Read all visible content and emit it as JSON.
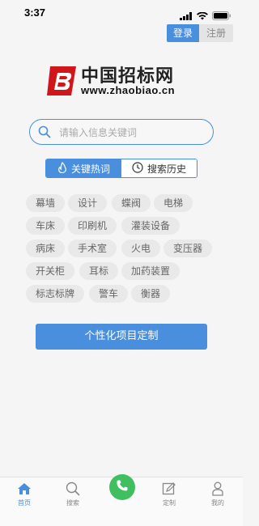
{
  "status": {
    "time": "3:37"
  },
  "auth": {
    "login": "登录",
    "register": "注册"
  },
  "logo": {
    "name_cn": "中国招标网",
    "url": "www.zhaobiao.cn"
  },
  "search": {
    "placeholder": "请输入信息关键词"
  },
  "tabs": {
    "hot": "关键热词",
    "history": "搜索历史",
    "active": "hot"
  },
  "hot_keywords": [
    "幕墙",
    "设计",
    "蝶阀",
    "电梯",
    "车床",
    "印刷机",
    "灌装设备",
    "病床",
    "手术室",
    "火电",
    "变压器",
    "开关柜",
    "耳标",
    "加药装置",
    "标志标牌",
    "警车",
    "衡器"
  ],
  "custom_button": "个性化项目定制",
  "tabbar": {
    "home": "首页",
    "search": "搜索",
    "custom": "定制",
    "mine": "我的",
    "active": "home"
  },
  "colors": {
    "primary": "#4a8ede",
    "call": "#3fbf5f",
    "logo_red": "#d0161b"
  }
}
